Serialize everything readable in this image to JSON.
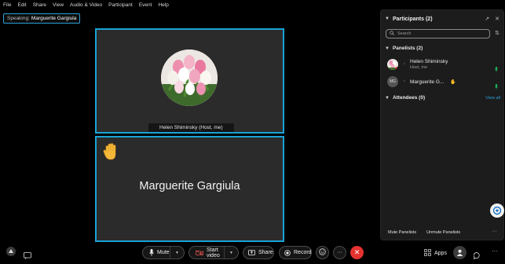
{
  "menu": [
    "File",
    "Edit",
    "Share",
    "View",
    "Audio & Video",
    "Participant",
    "Event",
    "Help"
  ],
  "speaking": {
    "label": "Speaking:",
    "name": "Marguerite Gargiula"
  },
  "tiles": {
    "top": {
      "nameplate": "Helen Shiminsky  (Host, me)"
    },
    "bottom": {
      "name": "Marguerite Gargiula",
      "reaction_icon": "raised-hand-icon"
    }
  },
  "panel": {
    "title": "Participants (2)",
    "search_placeholder": "Search",
    "panelists_header": "Panelists (2)",
    "panelists": [
      {
        "name": "Helen Shiminsky",
        "role": "Host, me"
      },
      {
        "name": "Marguerite G...",
        "initials": "MG"
      }
    ],
    "attendees_header": "Attendees (0)",
    "view_all": "View all",
    "mute_panelists": "Mute Panelists",
    "unmute_panelists": "Unmute Panelists",
    "more": "···"
  },
  "toolbar": {
    "mute": "Mute",
    "start_video": "Start video",
    "share": "Share",
    "record": "Record",
    "more": "···",
    "apps": "Apps"
  },
  "colors": {
    "accent": "#1aa3d6",
    "leave": "#e6322f",
    "active_mic": "#1fae5b"
  }
}
